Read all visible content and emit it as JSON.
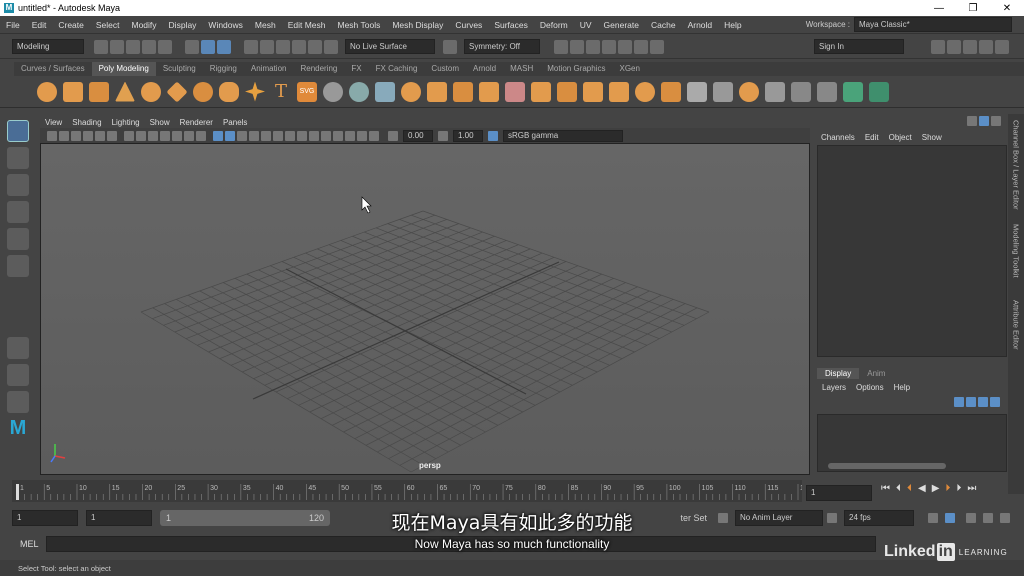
{
  "titlebar": {
    "title": "untitled* - Autodesk Maya",
    "min": "—",
    "max": "❐",
    "close": "✕"
  },
  "menu": [
    "File",
    "Edit",
    "Create",
    "Select",
    "Modify",
    "Display",
    "Windows",
    "Mesh",
    "Edit Mesh",
    "Mesh Tools",
    "Mesh Display",
    "Curves",
    "Surfaces",
    "Deform",
    "UV",
    "Generate",
    "Cache",
    "Arnold",
    "Help"
  ],
  "workspace": {
    "label": "Workspace :",
    "value": "Maya Classic*"
  },
  "status": {
    "mode": "Modeling",
    "live": "No Live Surface",
    "symmetry": "Symmetry: Off",
    "signin": "Sign In"
  },
  "shelf_tabs": [
    "Curves / Surfaces",
    "Poly Modeling",
    "Sculpting",
    "Rigging",
    "Animation",
    "Rendering",
    "FX",
    "FX Caching",
    "Custom",
    "Arnold",
    "MASH",
    "Motion Graphics",
    "XGen"
  ],
  "viewport": {
    "menus": [
      "View",
      "Shading",
      "Lighting",
      "Show",
      "Renderer",
      "Panels"
    ],
    "exposure": "0.00",
    "gamma": "1.00",
    "colorspace": "sRGB gamma",
    "camera": "persp"
  },
  "channels": {
    "menus": [
      "Channels",
      "Edit",
      "Object",
      "Show"
    ]
  },
  "layers": {
    "tabs": [
      "Display",
      "Anim"
    ],
    "menus": [
      "Layers",
      "Options",
      "Help"
    ]
  },
  "side_tabs": [
    "Channel Box / Layer Editor",
    "Modeling Toolkit",
    "Attribute Editor"
  ],
  "timeline": {
    "ticks": [
      "1",
      "5",
      "10",
      "15",
      "20",
      "25",
      "30",
      "35",
      "40",
      "45",
      "50",
      "55",
      "60",
      "65",
      "70",
      "75",
      "80",
      "85",
      "90",
      "95",
      "100",
      "105",
      "110",
      "115",
      "12"
    ],
    "current": "1"
  },
  "range": {
    "start": "1",
    "start2": "1",
    "inner_start": "1",
    "inner_end": "120",
    "char_set": "ter Set",
    "anim_layer": "No Anim Layer",
    "fps": "24 fps"
  },
  "cmd": {
    "label": "MEL"
  },
  "help": "Select Tool: select an object",
  "subtitles": {
    "cn": "现在Maya具有如此多的功能",
    "en": "Now Maya has so much functionality"
  },
  "brand": {
    "linked": "Linked",
    "in": "in",
    "learning": "LEARNING"
  }
}
